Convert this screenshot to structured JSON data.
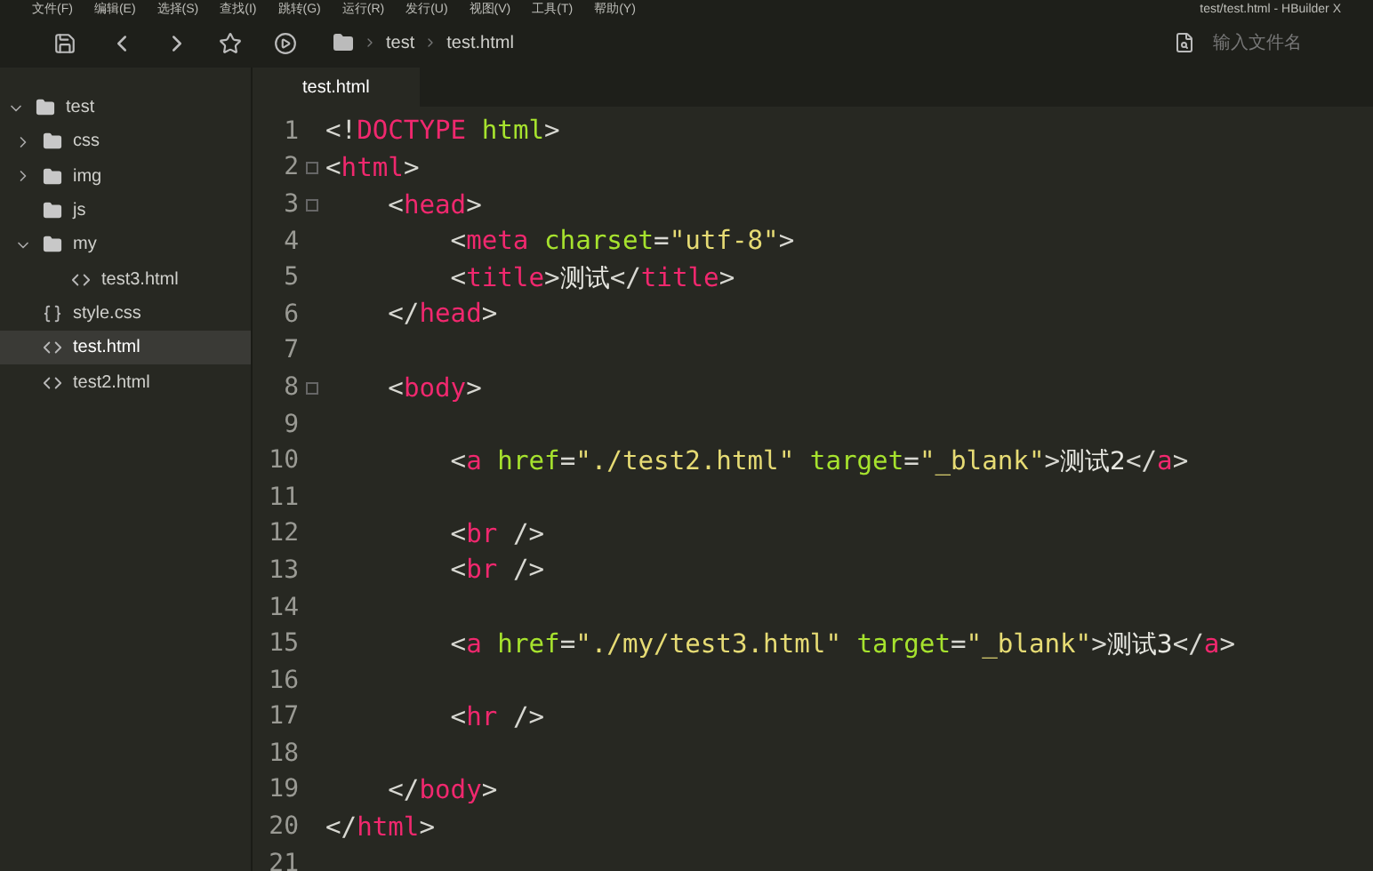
{
  "menu_bar": {
    "items": [
      "文件(F)",
      "编辑(E)",
      "选择(S)",
      "查找(I)",
      "跳转(G)",
      "运行(R)",
      "发行(U)",
      "视图(V)",
      "工具(T)",
      "帮助(Y)"
    ],
    "title": "test/test.html - HBuilder X"
  },
  "toolbar": {
    "breadcrumb": [
      "test",
      "test.html"
    ],
    "search": {
      "placeholder": "输入文件名"
    }
  },
  "sidebar": {
    "items": [
      {
        "label": "test",
        "kind": "folder",
        "expanded": true,
        "selected": false,
        "children": [
          {
            "label": "css",
            "kind": "folder",
            "expanded": false,
            "selected": false
          },
          {
            "label": "img",
            "kind": "folder",
            "expanded": false,
            "selected": false
          },
          {
            "label": "js",
            "kind": "folder",
            "selected": false
          },
          {
            "label": "my",
            "kind": "folder",
            "expanded": true,
            "selected": false,
            "children": [
              {
                "label": "test3.html",
                "kind": "html",
                "selected": false
              }
            ]
          },
          {
            "label": "style.css",
            "kind": "css",
            "selected": false
          },
          {
            "label": "test.html",
            "kind": "html",
            "selected": true
          },
          {
            "label": "test2.html",
            "kind": "html",
            "selected": false
          }
        ]
      }
    ]
  },
  "tabs": [
    {
      "label": "test.html",
      "selected": true
    }
  ],
  "editor": {
    "lines": [
      {
        "number": "1",
        "tokens": [
          {
            "kind": "punct",
            "text": "<!"
          },
          {
            "kind": "tag",
            "text": "DOCTYPE"
          },
          {
            "kind": "attr",
            "text": " html"
          },
          {
            "kind": "punct",
            "text": ">"
          }
        ]
      },
      {
        "number": "2",
        "foldable": true,
        "tokens": [
          {
            "kind": "punct",
            "text": "<"
          },
          {
            "kind": "tag",
            "text": "html"
          },
          {
            "kind": "punct",
            "text": ">"
          }
        ]
      },
      {
        "number": "3",
        "foldable": true,
        "tokens": [
          {
            "kind": "punct",
            "text": "    <"
          },
          {
            "kind": "tag",
            "text": "head"
          },
          {
            "kind": "punct",
            "text": ">"
          }
        ]
      },
      {
        "number": "4",
        "tokens": [
          {
            "kind": "punct",
            "text": "        <"
          },
          {
            "kind": "tag",
            "text": "meta"
          },
          {
            "kind": "attr",
            "text": " charset"
          },
          {
            "kind": "punct",
            "text": "="
          },
          {
            "kind": "string",
            "text": "\"utf-8\""
          },
          {
            "kind": "punct",
            "text": ">"
          }
        ]
      },
      {
        "number": "5",
        "tokens": [
          {
            "kind": "punct",
            "text": "        <"
          },
          {
            "kind": "tag",
            "text": "title"
          },
          {
            "kind": "punct",
            "text": ">"
          },
          {
            "kind": "text",
            "text": "测试"
          },
          {
            "kind": "punct",
            "text": "</"
          },
          {
            "kind": "tag",
            "text": "title"
          },
          {
            "kind": "punct",
            "text": ">"
          }
        ]
      },
      {
        "number": "6",
        "tokens": [
          {
            "kind": "punct",
            "text": "    </"
          },
          {
            "kind": "tag",
            "text": "head"
          },
          {
            "kind": "punct",
            "text": ">"
          }
        ]
      },
      {
        "number": "7"
      },
      {
        "number": "8",
        "foldable": true,
        "tokens": [
          {
            "kind": "punct",
            "text": "    <"
          },
          {
            "kind": "tag",
            "text": "body"
          },
          {
            "kind": "punct",
            "text": ">"
          }
        ]
      },
      {
        "number": "9"
      },
      {
        "number": "10",
        "tokens": [
          {
            "kind": "punct",
            "text": "        <"
          },
          {
            "kind": "tag",
            "text": "a"
          },
          {
            "kind": "attr",
            "text": " href"
          },
          {
            "kind": "punct",
            "text": "="
          },
          {
            "kind": "string",
            "text": "\"./test2.html\""
          },
          {
            "kind": "attr",
            "text": " target"
          },
          {
            "kind": "punct",
            "text": "="
          },
          {
            "kind": "string",
            "text": "\"_blank\""
          },
          {
            "kind": "punct",
            "text": ">"
          },
          {
            "kind": "text",
            "text": "测试2"
          },
          {
            "kind": "punct",
            "text": "</"
          },
          {
            "kind": "tag",
            "text": "a"
          },
          {
            "kind": "punct",
            "text": ">"
          }
        ]
      },
      {
        "number": "11"
      },
      {
        "number": "12",
        "tokens": [
          {
            "kind": "punct",
            "text": "        <"
          },
          {
            "kind": "tag",
            "text": "br"
          },
          {
            "kind": "punct",
            "text": " />"
          }
        ]
      },
      {
        "number": "13",
        "tokens": [
          {
            "kind": "punct",
            "text": "        <"
          },
          {
            "kind": "tag",
            "text": "br"
          },
          {
            "kind": "punct",
            "text": " />"
          }
        ]
      },
      {
        "number": "14"
      },
      {
        "number": "15",
        "tokens": [
          {
            "kind": "punct",
            "text": "        <"
          },
          {
            "kind": "tag",
            "text": "a"
          },
          {
            "kind": "attr",
            "text": " href"
          },
          {
            "kind": "punct",
            "text": "="
          },
          {
            "kind": "string",
            "text": "\"./my/test3.html\""
          },
          {
            "kind": "attr",
            "text": " target"
          },
          {
            "kind": "punct",
            "text": "="
          },
          {
            "kind": "string",
            "text": "\"_blank\""
          },
          {
            "kind": "punct",
            "text": ">"
          },
          {
            "kind": "text",
            "text": "测试3"
          },
          {
            "kind": "punct",
            "text": "</"
          },
          {
            "kind": "tag",
            "text": "a"
          },
          {
            "kind": "punct",
            "text": ">"
          }
        ]
      },
      {
        "number": "16"
      },
      {
        "number": "17",
        "tokens": [
          {
            "kind": "punct",
            "text": "        <"
          },
          {
            "kind": "tag",
            "text": "hr"
          },
          {
            "kind": "punct",
            "text": " />"
          }
        ]
      },
      {
        "number": "18"
      },
      {
        "number": "19",
        "tokens": [
          {
            "kind": "punct",
            "text": "    </"
          },
          {
            "kind": "tag",
            "text": "body"
          },
          {
            "kind": "punct",
            "text": ">"
          }
        ]
      },
      {
        "number": "20",
        "tokens": [
          {
            "kind": "punct",
            "text": "</"
          },
          {
            "kind": "tag",
            "text": "html"
          },
          {
            "kind": "punct",
            "text": ">"
          }
        ]
      },
      {
        "number": "21"
      }
    ]
  }
}
